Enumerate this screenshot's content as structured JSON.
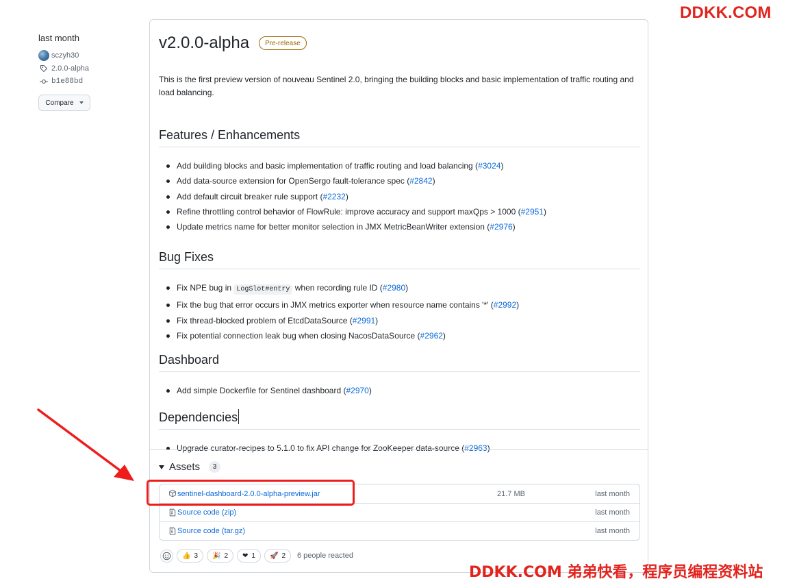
{
  "watermarks": {
    "top": "DDKK.COM",
    "bottom": "DDKK.COM 弟弟快看，程序员编程资料站",
    "color": "#e3231d"
  },
  "sidebar": {
    "date": "last month",
    "author": "sczyh30",
    "tag": "2.0.0-alpha",
    "commit": "b1e88bd",
    "compare_label": "Compare"
  },
  "release": {
    "title": "v2.0.0-alpha",
    "badge": "Pre-release",
    "intro": "This is the first preview version of nouveau Sentinel 2.0, bringing the building blocks and basic implementation of traffic routing and load balancing.",
    "sections": [
      {
        "heading": "Features / Enhancements",
        "items": [
          {
            "text": "Add building blocks and basic implementation of traffic routing and load balancing (",
            "ref": "#3024",
            "tail": ")"
          },
          {
            "text": "Add data-source extension for OpenSergo fault-tolerance spec (",
            "ref": "#2842",
            "tail": ")"
          },
          {
            "text": "Add default circuit breaker rule support (",
            "ref": "#2232",
            "tail": ")"
          },
          {
            "text": "Refine throttling control behavior of FlowRule: improve accuracy and support maxQps > 1000 (",
            "ref": "#2951",
            "tail": ")"
          },
          {
            "text": "Update metrics name for better monitor selection in JMX MetricBeanWriter extension (",
            "ref": "#2976",
            "tail": ")"
          }
        ]
      },
      {
        "heading": "Bug Fixes",
        "items": [
          {
            "pre": "Fix NPE bug in ",
            "code": "LogSlot#entry",
            "text": " when recording rule ID (",
            "ref": "#2980",
            "tail": ")"
          },
          {
            "text": "Fix the bug that error occurs in JMX metrics exporter when resource name contains '*' (",
            "ref": "#2992",
            "tail": ")"
          },
          {
            "text": "Fix thread-blocked problem of EtcdDataSource (",
            "ref": "#2991",
            "tail": ")"
          },
          {
            "text": "Fix potential connection leak bug when closing NacosDataSource (",
            "ref": "#2962",
            "tail": ")"
          }
        ]
      },
      {
        "heading": "Dashboard",
        "items": [
          {
            "text": "Add simple Dockerfile for Sentinel dashboard (",
            "ref": "#2970",
            "tail": ")"
          }
        ]
      },
      {
        "heading": "Dependencies",
        "items": [
          {
            "text": "Upgrade curator-recipes to 5.1.0 to fix API change for ZooKeeper data-source (",
            "ref": "#2963",
            "tail": ")"
          }
        ]
      }
    ]
  },
  "assets": {
    "title": "Assets",
    "count": "3",
    "rows": [
      {
        "name": "sentinel-dashboard-2.0.0-alpha-preview.jar",
        "sub": "",
        "size": "21.7 MB",
        "when": "last month",
        "icon": "package-icon"
      },
      {
        "name": "Source code",
        "sub": " (zip)",
        "size": "",
        "when": "last month",
        "icon": "file-zip-icon"
      },
      {
        "name": "Source code",
        "sub": " (tar.gz)",
        "size": "",
        "when": "last month",
        "icon": "file-zip-icon"
      }
    ]
  },
  "reactions": {
    "items": [
      {
        "emoji": "👍",
        "count": "3",
        "icon": "thumbs-up-icon"
      },
      {
        "emoji": "🎉",
        "count": "2",
        "icon": "hooray-icon"
      },
      {
        "emoji": "❤",
        "count": "1",
        "icon": "heart-icon"
      },
      {
        "emoji": "🚀",
        "count": "2",
        "icon": "rocket-icon"
      }
    ],
    "summary": "6 people reacted"
  },
  "annotation": {
    "color": "#ef1c1c"
  }
}
